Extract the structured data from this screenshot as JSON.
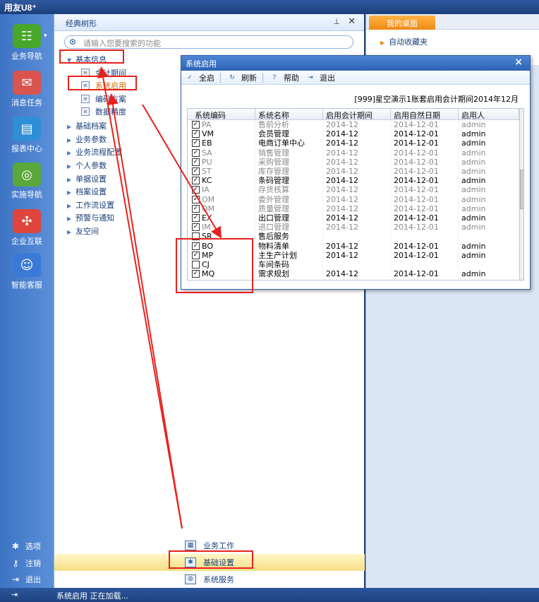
{
  "app": {
    "title": "用友U8⁺"
  },
  "left_nav": {
    "items": [
      {
        "label": "业务导航",
        "icon": "business-nav-icon",
        "color": "#48a72a"
      },
      {
        "label": "消息任务",
        "icon": "message-icon",
        "color": "#d9534f"
      },
      {
        "label": "报表中心",
        "icon": "report-icon",
        "color": "#2e8fd6"
      },
      {
        "label": "实施导航",
        "icon": "compass-icon",
        "color": "#5aa83a"
      },
      {
        "label": "企业互联",
        "icon": "connect-icon",
        "color": "#e0443c"
      },
      {
        "label": "智能客服",
        "icon": "service-icon",
        "color": "#3a7ad6"
      }
    ],
    "bottom": [
      {
        "label": "选项",
        "icon": "gear-icon"
      },
      {
        "label": "注销",
        "icon": "key-icon"
      },
      {
        "label": "退出",
        "icon": "exit-icon"
      }
    ]
  },
  "main_panel": {
    "title": "经典树形",
    "search_placeholder": "请输入您要搜索的功能",
    "tree": [
      {
        "label": "基本信息",
        "expanded": true,
        "children": [
          "会计期间",
          "系统启用",
          "编码方案",
          "数据精度"
        ]
      },
      {
        "label": "基础档案"
      },
      {
        "label": "业务参数"
      },
      {
        "label": "业务流程配置"
      },
      {
        "label": "个人参数"
      },
      {
        "label": "单据设置"
      },
      {
        "label": "档案设置"
      },
      {
        "label": "工作流设置"
      },
      {
        "label": "预警与通知"
      },
      {
        "label": "友空间"
      }
    ],
    "bottom_tabs": [
      {
        "label": "业务工作",
        "active": false
      },
      {
        "label": "基础设置",
        "active": true
      },
      {
        "label": "系统服务",
        "active": false
      }
    ]
  },
  "right_panel": {
    "tab": "我的桌面",
    "favorites": "自动收藏夹"
  },
  "dialog": {
    "title": "系统启用",
    "toolbar": [
      "全启",
      "刷新",
      "帮助",
      "退出"
    ],
    "info": "[999]星空演示1账套启用会计期间2014年12月",
    "columns": [
      "系统编码",
      "系统名称",
      "启用会计期间",
      "启用自然日期",
      "启用人"
    ],
    "rows": [
      {
        "checked": true,
        "enabled": false,
        "code": "PA",
        "name": "售前分析",
        "period": "2014-12",
        "date": "2014-12-01",
        "user": "admin"
      },
      {
        "checked": true,
        "enabled": true,
        "code": "VM",
        "name": "会员管理",
        "period": "2014-12",
        "date": "2014-12-01",
        "user": "admin"
      },
      {
        "checked": true,
        "enabled": true,
        "code": "EB",
        "name": "电商订单中心",
        "period": "2014-12",
        "date": "2014-12-01",
        "user": "admin"
      },
      {
        "checked": true,
        "enabled": false,
        "code": "SA",
        "name": "销售管理",
        "period": "2014-12",
        "date": "2014-12-01",
        "user": "admin"
      },
      {
        "checked": true,
        "enabled": false,
        "code": "PU",
        "name": "采购管理",
        "period": "2014-12",
        "date": "2014-12-01",
        "user": "admin"
      },
      {
        "checked": true,
        "enabled": false,
        "code": "ST",
        "name": "库存管理",
        "period": "2014-12",
        "date": "2014-12-01",
        "user": "admin"
      },
      {
        "checked": true,
        "enabled": true,
        "code": "KC",
        "name": "条码管理",
        "period": "2014-12",
        "date": "2014-12-01",
        "user": "admin"
      },
      {
        "checked": true,
        "enabled": false,
        "code": "IA",
        "name": "存货核算",
        "period": "2014-12",
        "date": "2014-12-01",
        "user": "admin"
      },
      {
        "checked": true,
        "enabled": false,
        "code": "OM",
        "name": "委外管理",
        "period": "2014-12",
        "date": "2014-12-01",
        "user": "admin"
      },
      {
        "checked": true,
        "enabled": false,
        "code": "QM",
        "name": "质量管理",
        "period": "2014-12",
        "date": "2014-12-01",
        "user": "admin"
      },
      {
        "checked": true,
        "enabled": true,
        "code": "EX",
        "name": "出口管理",
        "period": "2014-12",
        "date": "2014-12-01",
        "user": "admin"
      },
      {
        "checked": true,
        "enabled": false,
        "code": "IM",
        "name": "进口管理",
        "period": "2014-12",
        "date": "2014-12-01",
        "user": "admin"
      },
      {
        "checked": false,
        "enabled": true,
        "code": "SR",
        "name": "售后服务",
        "period": "",
        "date": "",
        "user": ""
      },
      {
        "checked": true,
        "enabled": true,
        "code": "BO",
        "name": "物料清单",
        "period": "2014-12",
        "date": "2014-12-01",
        "user": "admin"
      },
      {
        "checked": true,
        "enabled": true,
        "code": "MP",
        "name": "主生产计划",
        "period": "2014-12",
        "date": "2014-12-01",
        "user": "admin"
      },
      {
        "checked": false,
        "enabled": true,
        "code": "CJ",
        "name": "车间条码",
        "period": "",
        "date": "",
        "user": ""
      },
      {
        "checked": true,
        "enabled": true,
        "code": "MQ",
        "name": "需求规划",
        "period": "2014-12",
        "date": "2014-12-01",
        "user": "admin"
      }
    ]
  },
  "status": {
    "text": "系统启用 正在加载..."
  },
  "colors": {
    "highlight": "#e8211c",
    "accent": "#2d64b4",
    "active_tab": "#f7de86"
  }
}
